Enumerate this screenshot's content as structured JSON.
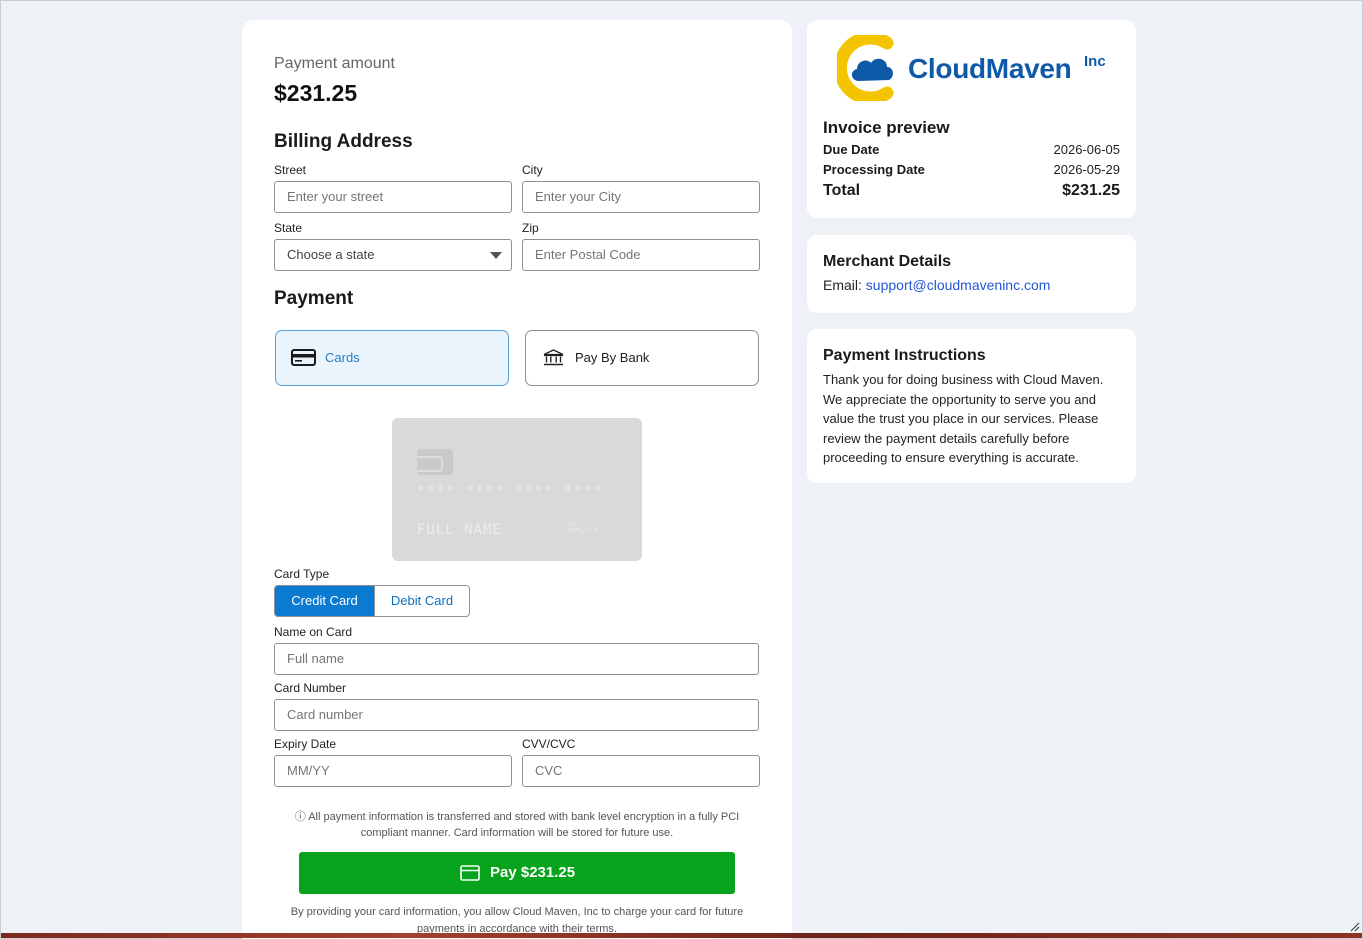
{
  "payment": {
    "amount_label": "Payment amount",
    "amount_value": "$231.25"
  },
  "billing": {
    "title": "Billing Address",
    "street_label": "Street",
    "street_placeholder": "Enter your street",
    "city_label": "City",
    "city_placeholder": "Enter your City",
    "state_label": "State",
    "state_selected": "Choose a state",
    "zip_label": "Zip",
    "zip_placeholder": "Enter Postal Code"
  },
  "payment_method": {
    "title": "Payment",
    "cards_label": "Cards",
    "bank_label": "Pay By Bank"
  },
  "card_preview": {
    "number_mask": "**** **** **** ****",
    "name_placeholder": "FULL NAME",
    "valid_thru": "VALID THRU",
    "expiry_mask": "**/**"
  },
  "card_form": {
    "type_label": "Card Type",
    "credit_label": "Credit Card",
    "debit_label": "Debit Card",
    "name_label": "Name on Card",
    "name_placeholder": "Full name",
    "number_label": "Card Number",
    "number_placeholder": "Card number",
    "expiry_label": "Expiry Date",
    "expiry_placeholder": "MM/YY",
    "cvc_label": "CVV/CVC",
    "cvc_placeholder": "CVC"
  },
  "notice": "ⓘ All payment information is transferred and stored with bank level encryption in a fully PCI compliant manner. Card information will be stored for future use.",
  "pay_button": "Pay $231.25",
  "consent": "By providing your card information, you allow Cloud Maven, Inc to charge your card for future payments in accordance with their terms.",
  "brand": {
    "name": "CloudMaven",
    "suffix": "Inc"
  },
  "invoice": {
    "title": "Invoice preview",
    "due_label": "Due Date",
    "due_value": "2026-06-05",
    "processing_label": "Processing Date",
    "processing_value": "2026-05-29",
    "total_label": "Total",
    "total_value": "$231.25"
  },
  "merchant": {
    "title": "Merchant Details",
    "email_label": "Email:",
    "email_value": "support@cloudmaveninc.com"
  },
  "instructions": {
    "title": "Payment Instructions",
    "text": "Thank you for doing business with Cloud Maven. We appreciate the opportunity to serve you and value the trust you place in our services. Please review the payment details carefully before proceeding to ensure everything is accurate."
  },
  "colors": {
    "accent_blue": "#0b7ad1",
    "pay_green": "#07a31c",
    "brand_blue": "#0f5aa8",
    "brand_yellow": "#f5c400",
    "link_blue": "#2456d6"
  },
  "icons": {
    "cards": "credit-card-icon",
    "bank": "bank-icon",
    "pay": "card-outline-icon",
    "info": "info-icon"
  }
}
